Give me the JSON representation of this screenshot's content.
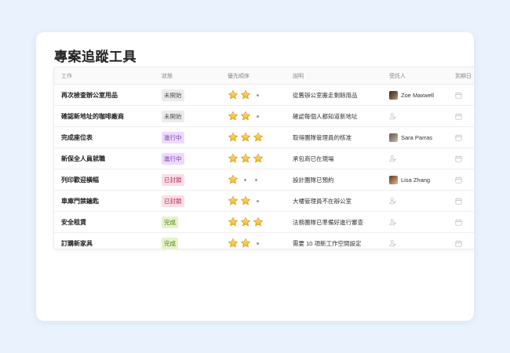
{
  "title": "專案追蹤工具",
  "columns": [
    "工作",
    "狀態",
    "優先順序",
    "說明",
    "受託人",
    "到期日"
  ],
  "rows": [
    {
      "task": "再次檢查辦公室用品",
      "status": "未開始",
      "priority": 2,
      "description": "從舊辦公室搬走剩餘用品",
      "assignee": "Zoe Maxwell"
    },
    {
      "task": "確認新地址的咖啡廠商",
      "status": "未開始",
      "priority": 2,
      "description": "確認每個人都知道新地址",
      "assignee": ""
    },
    {
      "task": "完成座位表",
      "status": "進行中",
      "priority": 3,
      "description": "取得團隊管理員的核准",
      "assignee": "Sara Parras"
    },
    {
      "task": "新保全人員就職",
      "status": "進行中",
      "priority": 3,
      "description": "承包商已在現場",
      "assignee": ""
    },
    {
      "task": "列印歡迎橫幅",
      "status": "已封鎖",
      "priority": 1,
      "description": "設計團隊已預約",
      "assignee": "Lisa Zhang"
    },
    {
      "task": "車庫門禁鑰匙",
      "status": "已封鎖",
      "priority": 2,
      "description": "大樓管理員不在辦公室",
      "assignee": ""
    },
    {
      "task": "安全租賃",
      "status": "完成",
      "priority": 3,
      "description": "法務團隊已準備好進行審查",
      "assignee": ""
    },
    {
      "task": "訂購新家具",
      "status": "完成",
      "priority": 2,
      "description": "需要 10 項新工作空間設定",
      "assignee": ""
    }
  ],
  "priority_max": 3,
  "status_colors": {
    "未開始": {
      "bg": "#ececec",
      "fg": "#555555"
    },
    "進行中": {
      "bg": "#ecdcfa",
      "fg": "#7c3bb8"
    },
    "已封鎖": {
      "bg": "#fbdde6",
      "fg": "#b2305a"
    },
    "完成": {
      "bg": "#e4f4c8",
      "fg": "#4f7f1c"
    }
  },
  "icons": {
    "priority": "star-icon",
    "empty_priority": "dot",
    "unassigned": "person-outline-icon",
    "due_date": "calendar-icon"
  }
}
